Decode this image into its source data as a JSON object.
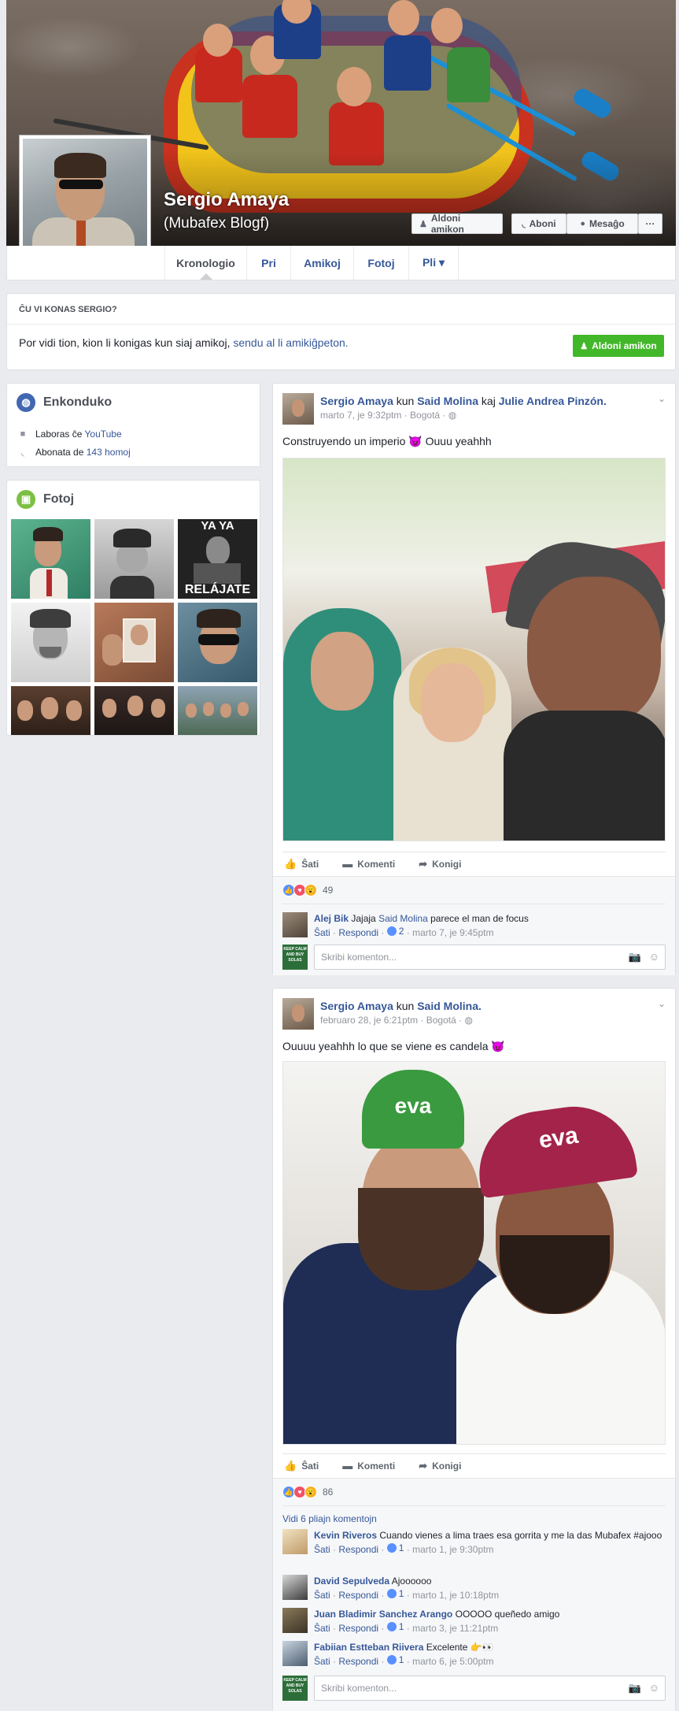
{
  "profile": {
    "name": "Sergio Amaya",
    "alternate_name": "(Mubafex Blogf)"
  },
  "cover_buttons": {
    "add_friend": "Aldoni amikon",
    "follow": "Aboni",
    "message": "Mesaĝo",
    "more": "···"
  },
  "nav": {
    "tabs": [
      "Kronologio",
      "Pri",
      "Amikoj",
      "Fotoj",
      "Pli ▾"
    ],
    "active": "Kronologio"
  },
  "know_box": {
    "title": "ĈU VI KONAS SERGIO?",
    "text": "Por vidi tion, kion li konigas kun siaj amikoj,",
    "link": "sendu al li amikiĝpeton.",
    "button": "Aldoni amikon"
  },
  "intro": {
    "title": "Enkonduko",
    "work_prefix": "Laboras ĉe",
    "work_link": "YouTube",
    "followers_prefix": "Abonata de",
    "followers_link": "143 homoj"
  },
  "photos": {
    "title": "Fotoj",
    "thumb3_top_text": "YA YA",
    "thumb3_bottom_text": "RELÁJATE"
  },
  "post1": {
    "author": "Sergio Amaya",
    "with_word": "kun",
    "tag1": "Said Molina",
    "and_word": "kaj",
    "tag2": "Julie Andrea Pinzón.",
    "meta": "marto 7, je 9:32ptm · Bogotá · ◍",
    "text": "Construyendo un imperio 😈 Ouuu yeahhh",
    "reaction_count": "49",
    "comment": {
      "author": "Alej Bik",
      "text_pre": "Jajaja",
      "mention": "Said Molina",
      "text_post": "parece el man de focus",
      "likes": "2",
      "time": "marto 7, je 9:45ptm"
    }
  },
  "post2": {
    "author": "Sergio Amaya",
    "with_word": "kun",
    "tag1": "Said Molina.",
    "meta": "februaro 28, je 6:21ptm · Bogotá · ◍",
    "text": "Ouuuu yeahhh lo que se viene es candela 😈",
    "reaction_count": "86",
    "view_more": "Vidi 6 pliajn komentojn",
    "comments": [
      {
        "author": "Kevin Riveros",
        "text": "Cuando vienes a lima traes esa gorrita y me la das Mubafex #ajooo",
        "likes": "1",
        "time": "marto 1, je 9:30ptm"
      },
      {
        "author": "David Sepulveda",
        "text": "Ajoooooo",
        "likes": "1",
        "time": "marto 1, je 10:18ptm"
      },
      {
        "author": "Juan Bladimir Sanchez Arango",
        "text": "OOOOO queñedo amigo",
        "likes": "1",
        "time": "marto 3, je 11:21ptm"
      },
      {
        "author": "Fabiian Estteban Riivera",
        "text": "Excelente 👉👀",
        "likes": "1",
        "time": "marto 6, je 5:00ptm"
      }
    ]
  },
  "actions": {
    "like": "Ŝati",
    "comment": "Komenti",
    "share": "Konigi",
    "reply": "Respondi"
  },
  "composer": {
    "placeholder": "Skribi komenton...",
    "avatar_text": "KEEP CALM AND BUY SOLAS"
  },
  "colors": {
    "accent": "#365899",
    "green": "#42b72a",
    "background": "#e9ebee"
  }
}
